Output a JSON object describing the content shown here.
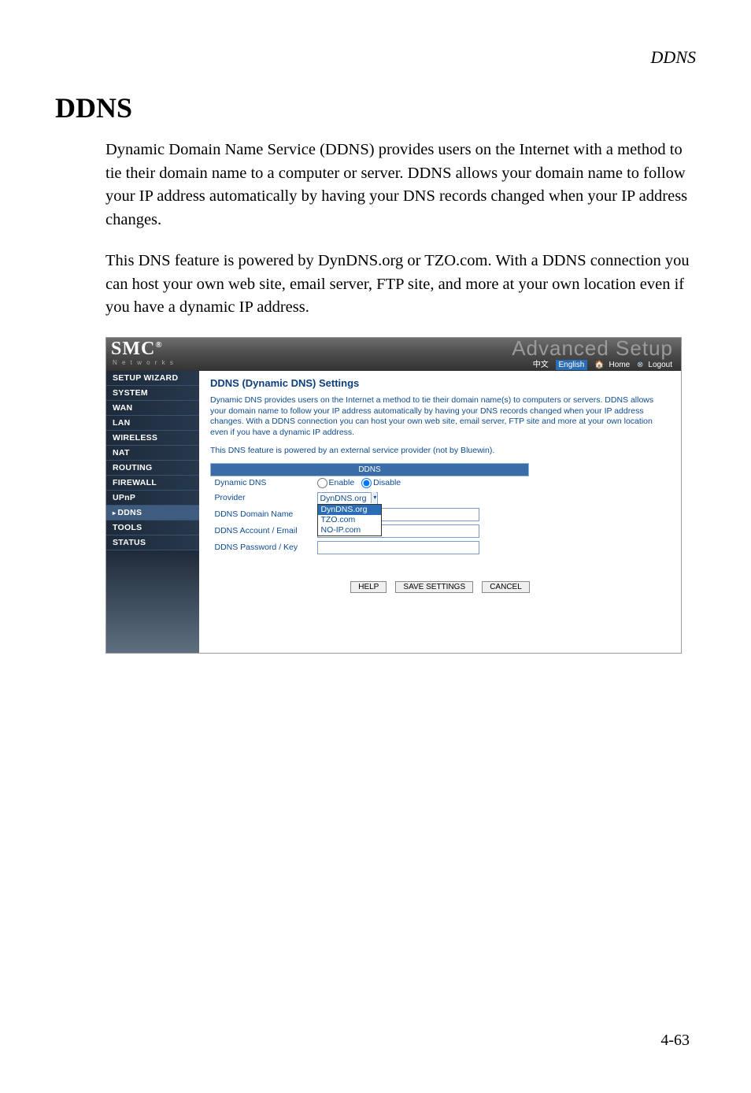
{
  "runningHead": "DDNS",
  "title": "DDNS",
  "para1": "Dynamic Domain Name Service (DDNS) provides users on the Internet with a method to tie their domain name to a computer or server. DDNS allows your domain name to follow your IP address automatically by having your DNS records changed when your IP address changes.",
  "para2": "This DNS feature is powered by DynDNS.org or TZO.com. With a DDNS connection you can host your own web site, email server, FTP site, and more at your own location even if you have a dynamic IP address.",
  "pageNum": "4-63",
  "ss": {
    "logo": "SMC",
    "logoReg": "®",
    "logoSub": "N e t w o r k s",
    "adv": "Advanced Setup",
    "lang_cn": "中文",
    "lang_en": "English",
    "home": "Home",
    "logout": "Logout",
    "nav": [
      "SETUP WIZARD",
      "SYSTEM",
      "WAN",
      "LAN",
      "WIRELESS",
      "NAT",
      "ROUTING",
      "FIREWALL",
      "UPnP",
      "DDNS",
      "TOOLS",
      "STATUS"
    ],
    "navActiveIndex": 9,
    "contentTitle": "DDNS (Dynamic DNS) Settings",
    "contentIntro": "Dynamic DNS provides users on the Internet a method to tie their domain name(s) to computers or servers. DDNS allows your domain name to follow your IP address automatically by having your DNS records changed when your IP address changes. With a DDNS connection you can host your own web site, email server, FTP site and more at your own location even if you have a dynamic IP address.",
    "contentNote": "This DNS feature is powered by an external service provider (not by Bluewin).",
    "tableHeader": "DDNS",
    "rows": {
      "dynDnsLabel": "Dynamic DNS",
      "enable": "Enable",
      "disable": "Disable",
      "providerLabel": "Provider",
      "providerSelected": "DynDNS.org",
      "providerOptions": [
        "DynDNS.org",
        "TZO.com",
        "NO-IP.com"
      ],
      "domainLabel": "DDNS Domain Name",
      "accountLabel": "DDNS Account / Email",
      "passwordLabel": "DDNS Password / Key"
    },
    "buttons": {
      "help": "HELP",
      "save": "SAVE SETTINGS",
      "cancel": "CANCEL"
    }
  }
}
